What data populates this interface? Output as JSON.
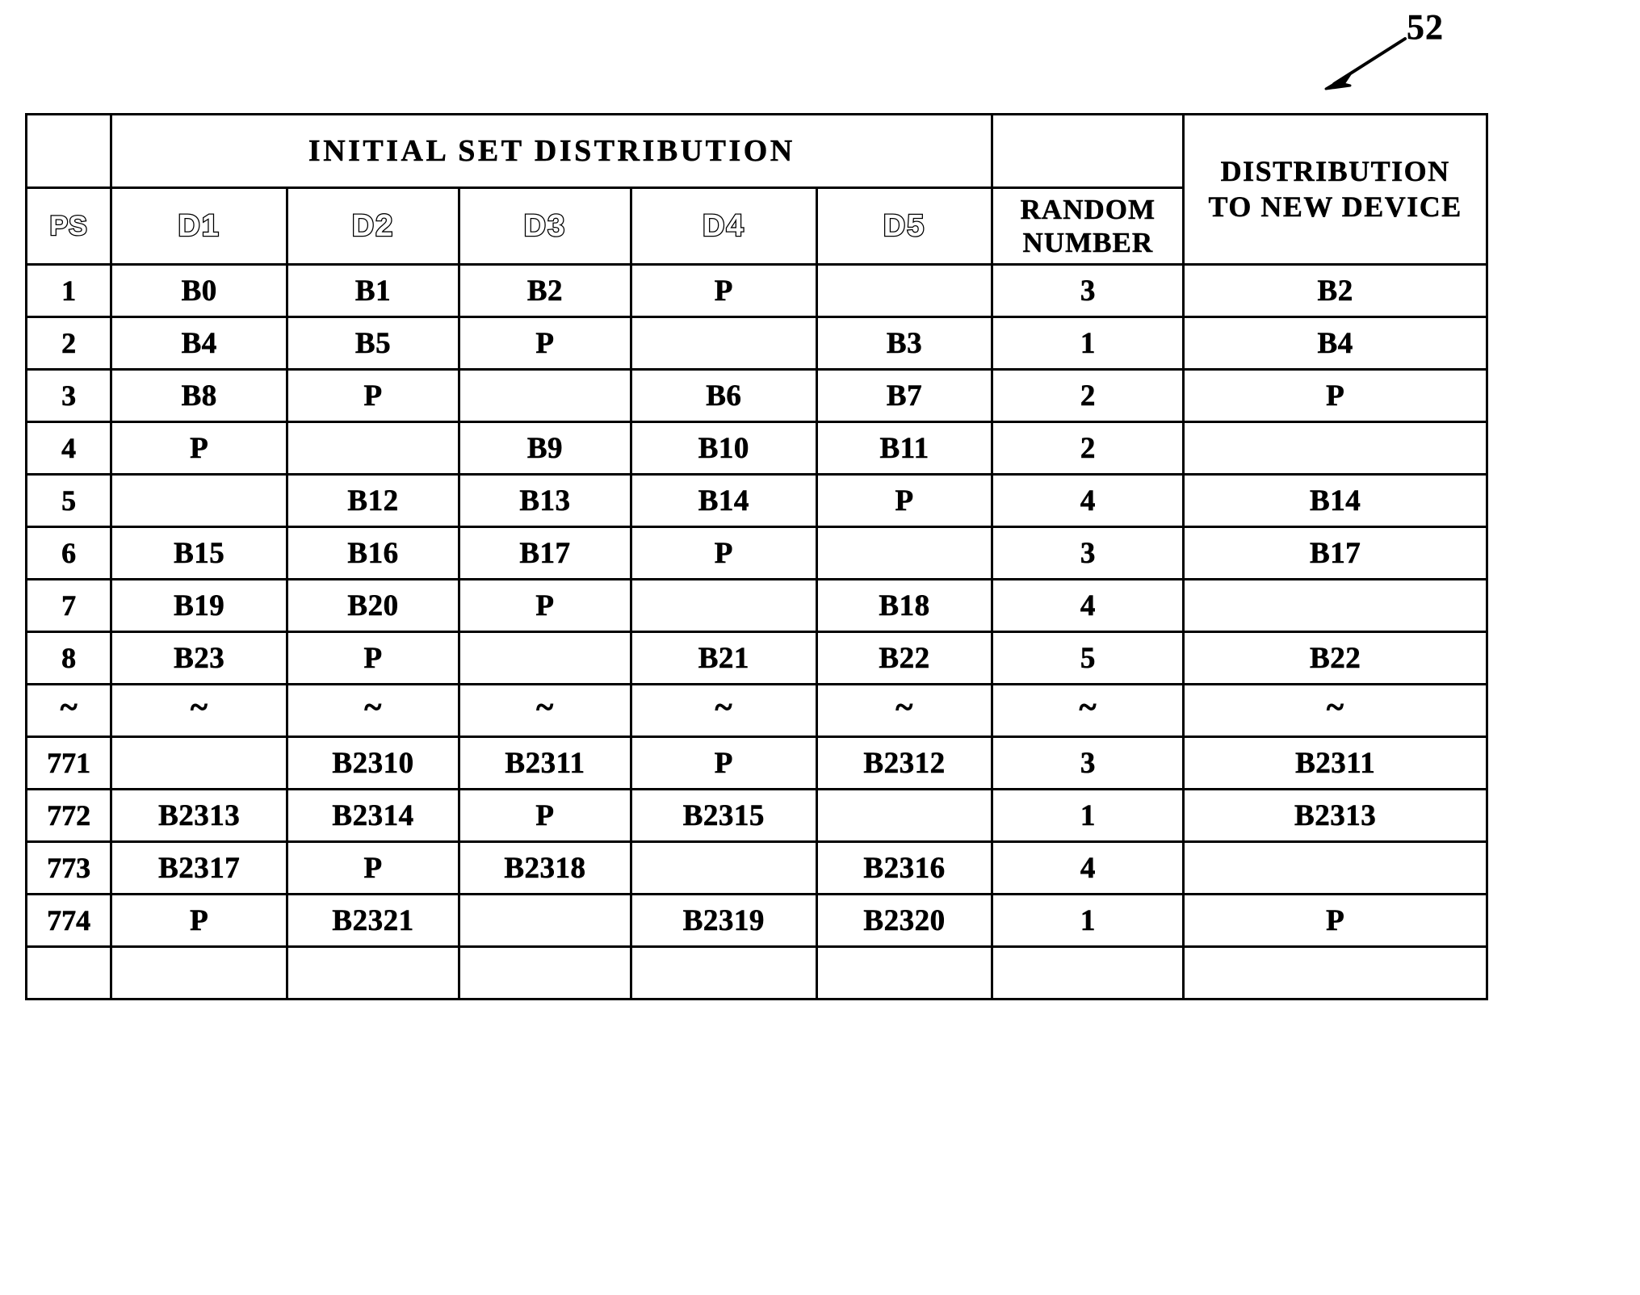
{
  "figure": {
    "reference_numeral": "52",
    "leader_arrow": "diagonal-arrow-pointing-down-left"
  },
  "table": {
    "group_header": {
      "initial_set_distribution": "INITIAL SET DISTRIBUTION",
      "distribution_to_new_device_line1": "DISTRIBUTION",
      "distribution_to_new_device_line2": "TO NEW DEVICE"
    },
    "columns": [
      {
        "key": "ps",
        "label": "PS",
        "style": "outline"
      },
      {
        "key": "d1",
        "label": "D1",
        "style": "outline"
      },
      {
        "key": "d2",
        "label": "D2",
        "style": "outline"
      },
      {
        "key": "d3",
        "label": "D3",
        "style": "outline"
      },
      {
        "key": "d4",
        "label": "D4",
        "style": "outline"
      },
      {
        "key": "d5",
        "label": "D5",
        "style": "outline"
      },
      {
        "key": "rand",
        "label_line1": "RANDOM",
        "label_line2": "NUMBER",
        "style": "solid"
      },
      {
        "key": "dist",
        "label_line1": "DISTRIBUTION",
        "label_line2": "TO NEW DEVICE",
        "style": "solid"
      }
    ],
    "rows": [
      {
        "ps": "1",
        "d1": "B0",
        "d2": "B1",
        "d3": "B2",
        "d4": "P",
        "d5": "",
        "rand": "3",
        "dist": "B2"
      },
      {
        "ps": "2",
        "d1": "B4",
        "d2": "B5",
        "d3": "P",
        "d4": "",
        "d5": "B3",
        "rand": "1",
        "dist": "B4"
      },
      {
        "ps": "3",
        "d1": "B8",
        "d2": "P",
        "d3": "",
        "d4": "B6",
        "d5": "B7",
        "rand": "2",
        "dist": "P"
      },
      {
        "ps": "4",
        "d1": "P",
        "d2": "",
        "d3": "B9",
        "d4": "B10",
        "d5": "B11",
        "rand": "2",
        "dist": ""
      },
      {
        "ps": "5",
        "d1": "",
        "d2": "B12",
        "d3": "B13",
        "d4": "B14",
        "d5": "P",
        "rand": "4",
        "dist": "B14"
      },
      {
        "ps": "6",
        "d1": "B15",
        "d2": "B16",
        "d3": "B17",
        "d4": "P",
        "d5": "",
        "rand": "3",
        "dist": "B17"
      },
      {
        "ps": "7",
        "d1": "B19",
        "d2": "B20",
        "d3": "P",
        "d4": "",
        "d5": "B18",
        "rand": "4",
        "dist": ""
      },
      {
        "ps": "8",
        "d1": "B23",
        "d2": "P",
        "d3": "",
        "d4": "B21",
        "d5": "B22",
        "rand": "5",
        "dist": "B22"
      },
      {
        "ps": "~",
        "d1": "~",
        "d2": "~",
        "d3": "~",
        "d4": "~",
        "d5": "~",
        "rand": "~",
        "dist": "~",
        "ellipsis": true
      },
      {
        "ps": "771",
        "d1": "",
        "d2": "B2310",
        "d3": "B2311",
        "d4": "P",
        "d5": "B2312",
        "rand": "3",
        "dist": "B2311"
      },
      {
        "ps": "772",
        "d1": "B2313",
        "d2": "B2314",
        "d3": "P",
        "d4": "B2315",
        "d5": "",
        "rand": "1",
        "dist": "B2313"
      },
      {
        "ps": "773",
        "d1": "B2317",
        "d2": "P",
        "d3": "B2318",
        "d4": "",
        "d5": "B2316",
        "rand": "4",
        "dist": ""
      },
      {
        "ps": "774",
        "d1": "P",
        "d2": "B2321",
        "d3": "",
        "d4": "B2319",
        "d5": "B2320",
        "rand": "1",
        "dist": "P"
      },
      {
        "ps": "",
        "d1": "",
        "d2": "",
        "d3": "",
        "d4": "",
        "d5": "",
        "rand": "",
        "dist": ""
      }
    ]
  },
  "colors": {
    "ink": "#000000",
    "paper": "#ffffff"
  }
}
